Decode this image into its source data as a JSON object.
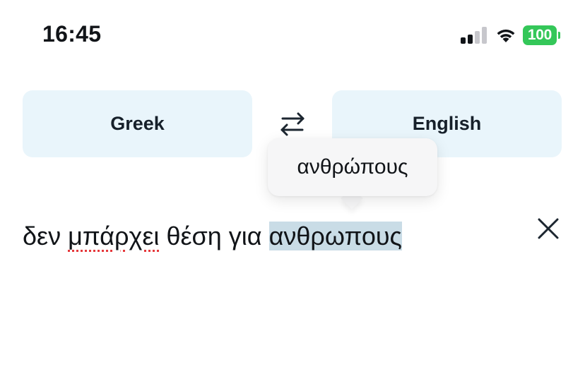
{
  "status_bar": {
    "time": "16:45",
    "battery_level": "100",
    "signal_bars_filled": 2,
    "signal_bars_total": 4,
    "colors": {
      "battery": "#34c759"
    }
  },
  "languages": {
    "source": "Greek",
    "target": "English",
    "swap_icon": "swap-arrows-icon"
  },
  "input": {
    "word_1": "δεν",
    "word_2": "μπάρχει",
    "word_3": "θέση",
    "word_4": "για",
    "selected_word": "ανθρωπους",
    "clear_icon": "close-icon"
  },
  "suggestion": {
    "text": "ανθρώπους"
  },
  "colors": {
    "language_button_bg": "#e9f5fb",
    "selection_highlight": "#c9dce6",
    "spellcheck_underline": "#e5383b"
  }
}
